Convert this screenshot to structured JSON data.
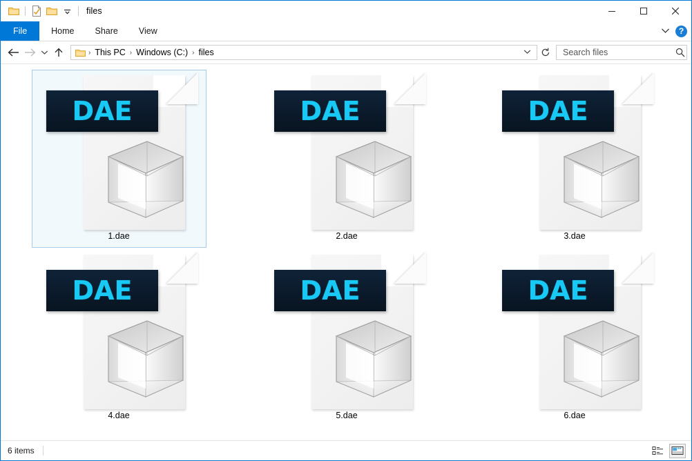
{
  "window": {
    "title": "files",
    "quick_access": [
      {
        "name": "folder-icon",
        "label": ""
      },
      {
        "name": "properties-icon",
        "label": ""
      },
      {
        "name": "new-folder-icon",
        "label": ""
      },
      {
        "name": "customize-qat-dropdown",
        "label": "▾"
      }
    ],
    "controls": {
      "minimize": "─",
      "maximize": "□",
      "close": "✕"
    },
    "accent_color": "#0078d7"
  },
  "ribbon": {
    "tabs": [
      {
        "id": "file",
        "label": "File",
        "active": true
      },
      {
        "id": "home",
        "label": "Home",
        "active": false
      },
      {
        "id": "share",
        "label": "Share",
        "active": false
      },
      {
        "id": "view",
        "label": "View",
        "active": false
      }
    ],
    "expand_label": "⌄",
    "help_label": "?"
  },
  "address": {
    "back_label": "←",
    "forward_label": "→",
    "recent_label": "⌄",
    "up_label": "↑",
    "breadcrumb": [
      {
        "label": "This PC"
      },
      {
        "label": "Windows (C:)"
      },
      {
        "label": "files"
      }
    ],
    "breadcrumb_separator": "›",
    "dropdown_label": "⌄",
    "refresh_label": "↻"
  },
  "search": {
    "placeholder": "Search files",
    "value": "",
    "icon": "search-icon"
  },
  "files": [
    {
      "name": "1.dae",
      "type": "DAE",
      "selected": true
    },
    {
      "name": "2.dae",
      "type": "DAE",
      "selected": false
    },
    {
      "name": "3.dae",
      "type": "DAE",
      "selected": false
    },
    {
      "name": "4.dae",
      "type": "DAE",
      "selected": false
    },
    {
      "name": "5.dae",
      "type": "DAE",
      "selected": false
    },
    {
      "name": "6.dae",
      "type": "DAE",
      "selected": false
    }
  ],
  "icon_style": {
    "banner_bg": "#0b1a2b",
    "banner_text_color": "#18c8f5",
    "page_bg": "#f3f3f3"
  },
  "status": {
    "item_count": "6 items",
    "views": [
      {
        "id": "details",
        "name": "details-view-icon",
        "active": false
      },
      {
        "id": "large-icons",
        "name": "large-icons-view-icon",
        "active": true
      }
    ]
  }
}
